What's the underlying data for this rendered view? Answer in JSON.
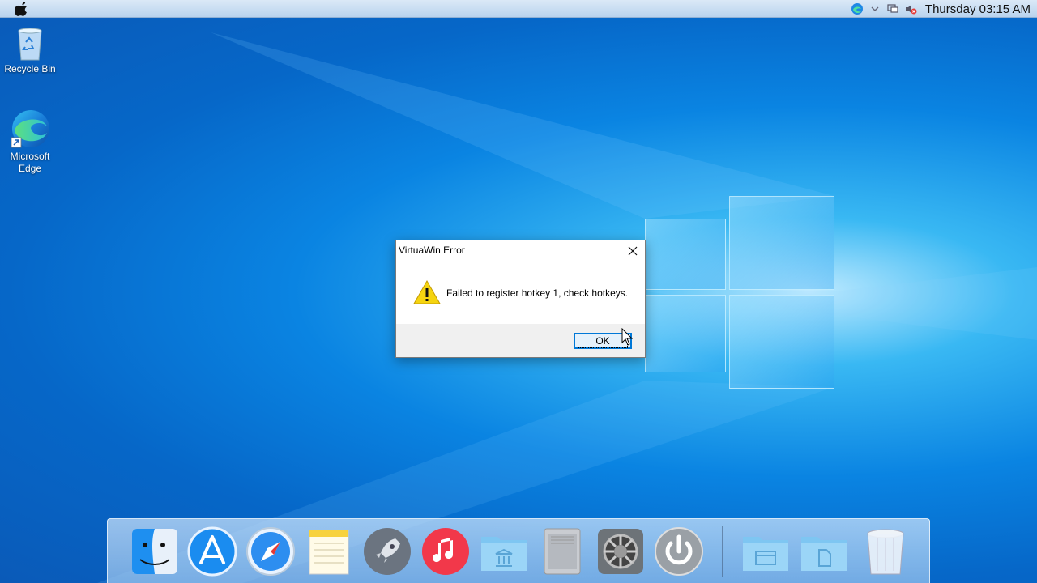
{
  "menubar": {
    "clock": "Thursday 03:15 AM",
    "icons": [
      "apple-icon",
      "edge-tray-icon",
      "chevron-down-icon",
      "network-icon",
      "volume-muted-icon"
    ]
  },
  "desktop": {
    "icons": [
      {
        "label": "Recycle Bin",
        "icon": "recycle-bin-icon"
      },
      {
        "label": "Microsoft Edge",
        "icon": "edge-icon"
      }
    ]
  },
  "dialog": {
    "title": "VirtuaWin Error",
    "message": "Failed to register hotkey 1, check hotkeys.",
    "ok_label": "OK",
    "icon": "warning-icon"
  },
  "dock": {
    "items": [
      "finder-icon",
      "app-store-icon",
      "safari-icon",
      "notes-icon",
      "launchpad-icon",
      "music-icon",
      "applications-folder-icon",
      "mac-pro-icon",
      "system-preferences-icon",
      "power-icon",
      "documents-folder-icon",
      "files-folder-icon",
      "trash-icon"
    ]
  },
  "colors": {
    "accent": "#0078d7",
    "warning": "#f5d410",
    "desktop": "#0a84e2"
  }
}
